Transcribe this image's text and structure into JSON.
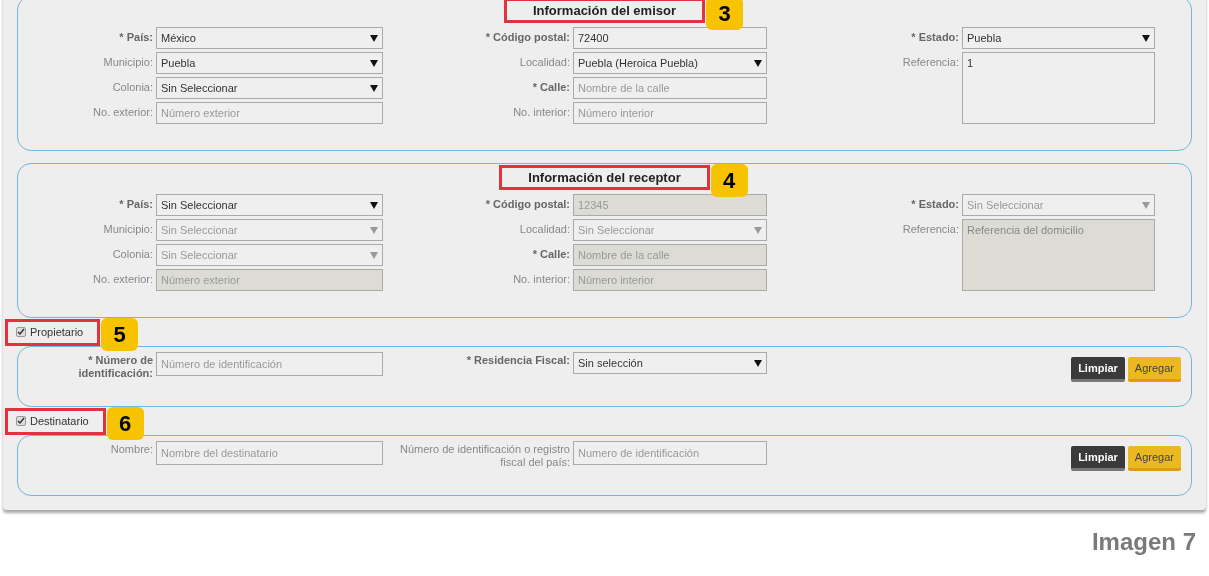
{
  "sections": [
    {
      "title": "Información del emisor",
      "badge": "3",
      "columns": [
        [
          {
            "kind": "select",
            "label": "* País:",
            "required": true,
            "value": "México",
            "disabled": false
          },
          {
            "kind": "select",
            "label": "Municipio:",
            "required": false,
            "value": "Puebla",
            "disabled": false
          },
          {
            "kind": "select",
            "label": "Colonia:",
            "required": false,
            "value": "Sin Seleccionar",
            "disabled": false
          },
          {
            "kind": "text",
            "label": "No. exterior:",
            "required": false,
            "placeholder": "Número exterior",
            "disabled": false
          }
        ],
        [
          {
            "kind": "text",
            "label": "* Código postal:",
            "required": true,
            "value": "72400",
            "disabled": false
          },
          {
            "kind": "select",
            "label": "Localidad:",
            "required": false,
            "value": "Puebla (Heroica Puebla)",
            "disabled": false
          },
          {
            "kind": "text",
            "label": "* Calle:",
            "required": true,
            "placeholder": "Nombre de la calle",
            "disabled": false
          },
          {
            "kind": "text",
            "label": "No. interior:",
            "required": false,
            "placeholder": "Número interior",
            "disabled": false
          }
        ],
        [
          {
            "kind": "select",
            "label": "* Estado:",
            "required": true,
            "value": "Puebla",
            "disabled": false
          },
          {
            "kind": "textarea",
            "label": "Referencia:",
            "required": false,
            "value": "1",
            "disabled": false
          }
        ]
      ]
    },
    {
      "title": "Información del receptor",
      "badge": "4",
      "columns": [
        [
          {
            "kind": "select",
            "label": "* País:",
            "required": true,
            "value": "Sin Seleccionar",
            "disabled": false
          },
          {
            "kind": "select",
            "label": "Municipio:",
            "required": false,
            "value": "Sin Seleccionar",
            "disabled": true
          },
          {
            "kind": "select",
            "label": "Colonia:",
            "required": false,
            "value": "Sin Seleccionar",
            "disabled": true
          },
          {
            "kind": "text",
            "label": "No. exterior:",
            "required": false,
            "placeholder": "Número exterior",
            "disabled": true
          }
        ],
        [
          {
            "kind": "text",
            "label": "* Código postal:",
            "required": true,
            "value": "12345",
            "disabled": true
          },
          {
            "kind": "select",
            "label": "Localidad:",
            "required": false,
            "value": "Sin Seleccionar",
            "disabled": true
          },
          {
            "kind": "text",
            "label": "* Calle:",
            "required": true,
            "placeholder": "Nombre de la calle",
            "disabled": true
          },
          {
            "kind": "text",
            "label": "No. interior:",
            "required": false,
            "placeholder": "Número interior",
            "disabled": true
          }
        ],
        [
          {
            "kind": "select",
            "label": "* Estado:",
            "required": true,
            "value": "Sin Seleccionar",
            "disabled": true
          },
          {
            "kind": "textarea",
            "label": "Referencia:",
            "required": false,
            "placeholder": "Referencia del domicilio",
            "disabled": true
          }
        ]
      ]
    }
  ],
  "groups": [
    {
      "label": "Propietario",
      "checked": true,
      "badge": "5",
      "fields": [
        {
          "kind": "text",
          "label": "* Número de identificación:",
          "required": true,
          "placeholder": "Número de identificación",
          "disabled": false
        },
        {
          "kind": "select",
          "label": "* Residencia Fiscal:",
          "required": true,
          "value": "Sin selección",
          "disabled": false
        }
      ],
      "buttons": [
        {
          "label": "Limpiar",
          "kind": "secondary"
        },
        {
          "label": "Agregar",
          "kind": "primary"
        }
      ]
    },
    {
      "label": "Destinatario",
      "checked": true,
      "badge": "6",
      "fields": [
        {
          "kind": "text",
          "label": "Nombre:",
          "required": false,
          "placeholder": "Nombre del destinatario",
          "disabled": false
        },
        {
          "kind": "text",
          "label": "Número de identificación o registro fiscal del país:",
          "required": false,
          "placeholder": "Numero de identificación",
          "disabled": false
        }
      ],
      "buttons": [
        {
          "label": "Limpiar",
          "kind": "secondary"
        },
        {
          "label": "Agregar",
          "kind": "primary"
        }
      ]
    }
  ],
  "caption": "Imagen 7"
}
